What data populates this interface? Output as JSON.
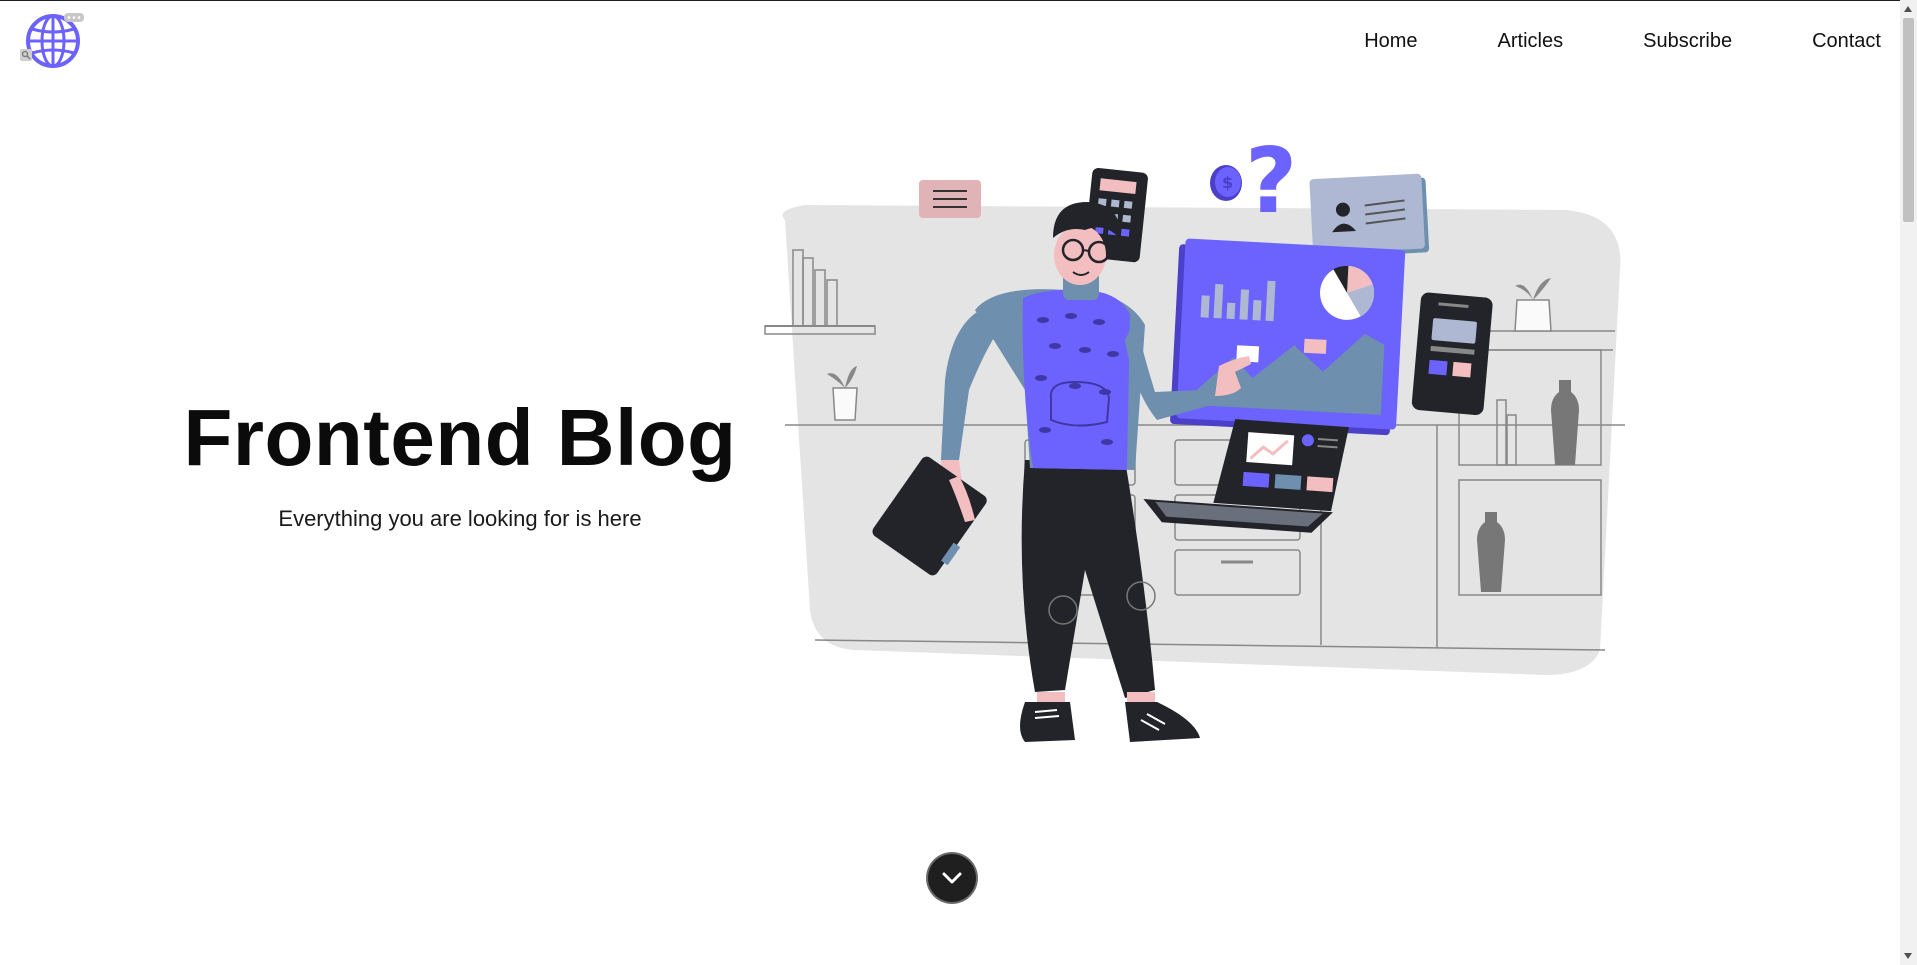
{
  "nav": {
    "items": [
      {
        "label": "Home"
      },
      {
        "label": "Articles"
      },
      {
        "label": "Subscribe"
      },
      {
        "label": "Contact"
      }
    ]
  },
  "hero": {
    "title": "Frontend Blog",
    "subtitle": "Everything you are looking for is here"
  },
  "icons": {
    "logo": "globe-icon",
    "scroll_down": "chevron-down-icon"
  },
  "colors": {
    "accent": "#6C63FF",
    "dark": "#22242a",
    "panel_bg": "#e4e4e4",
    "pink": "#f3bec0",
    "steel": "#6f8fae"
  }
}
